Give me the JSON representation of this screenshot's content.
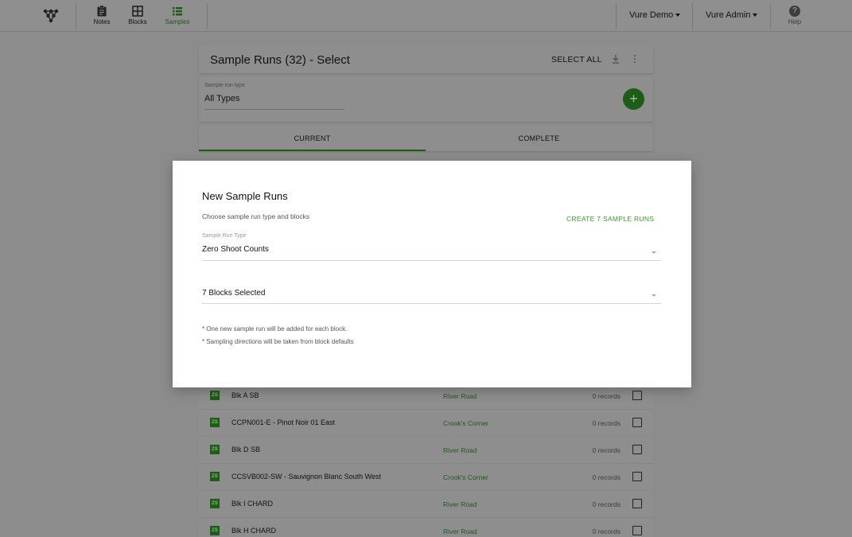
{
  "topbar": {
    "nav": [
      {
        "label": "Notes",
        "icon": "clipboard-icon"
      },
      {
        "label": "Blocks",
        "icon": "grid-icon"
      },
      {
        "label": "Samples",
        "icon": "list-icon"
      }
    ],
    "org_menu": "Vure Demo",
    "user_menu": "Vure Admin",
    "help_label": "Help"
  },
  "header": {
    "title": "Sample Runs (32) - Select",
    "select_all": "SELECT ALL"
  },
  "filter": {
    "label": "Sample run type",
    "value": "All Types"
  },
  "tabs": [
    "CURRENT",
    "COMPLETE"
  ],
  "rows": [
    {
      "badge": "ZS",
      "name": "Blk A SB",
      "location": "River Road",
      "records": "0 records"
    },
    {
      "badge": "ZS",
      "name": "CCPN001-E - Pinot Noir 01 East",
      "location": "Crook's Corner",
      "records": "0 records"
    },
    {
      "badge": "ZS",
      "name": "Blk D SB",
      "location": "River Road",
      "records": "0 records"
    },
    {
      "badge": "ZS",
      "name": "CCSVB002-SW - Sauvignon Blanc South West",
      "location": "Crook's Corner",
      "records": "0 records"
    },
    {
      "badge": "ZS",
      "name": "Blk I CHARD",
      "location": "River Road",
      "records": "0 records"
    },
    {
      "badge": "ZS",
      "name": "Blk H CHARD",
      "location": "River Road",
      "records": "0 records"
    }
  ],
  "modal": {
    "title": "New Sample Runs",
    "subtitle": "Choose sample run type and blocks",
    "create_button": "CREATE 7 SAMPLE RUNS",
    "type_label": "Sample Run Type",
    "type_value": "Zero Shoot Counts",
    "blocks_value": "7 Blocks Selected",
    "notes": [
      "* One new sample run will be added for each block.",
      "* Sampling directions will be taken from block defaults"
    ]
  },
  "colors": {
    "accent": "#3b9a2b",
    "accent_dark": "#1e5d16"
  }
}
